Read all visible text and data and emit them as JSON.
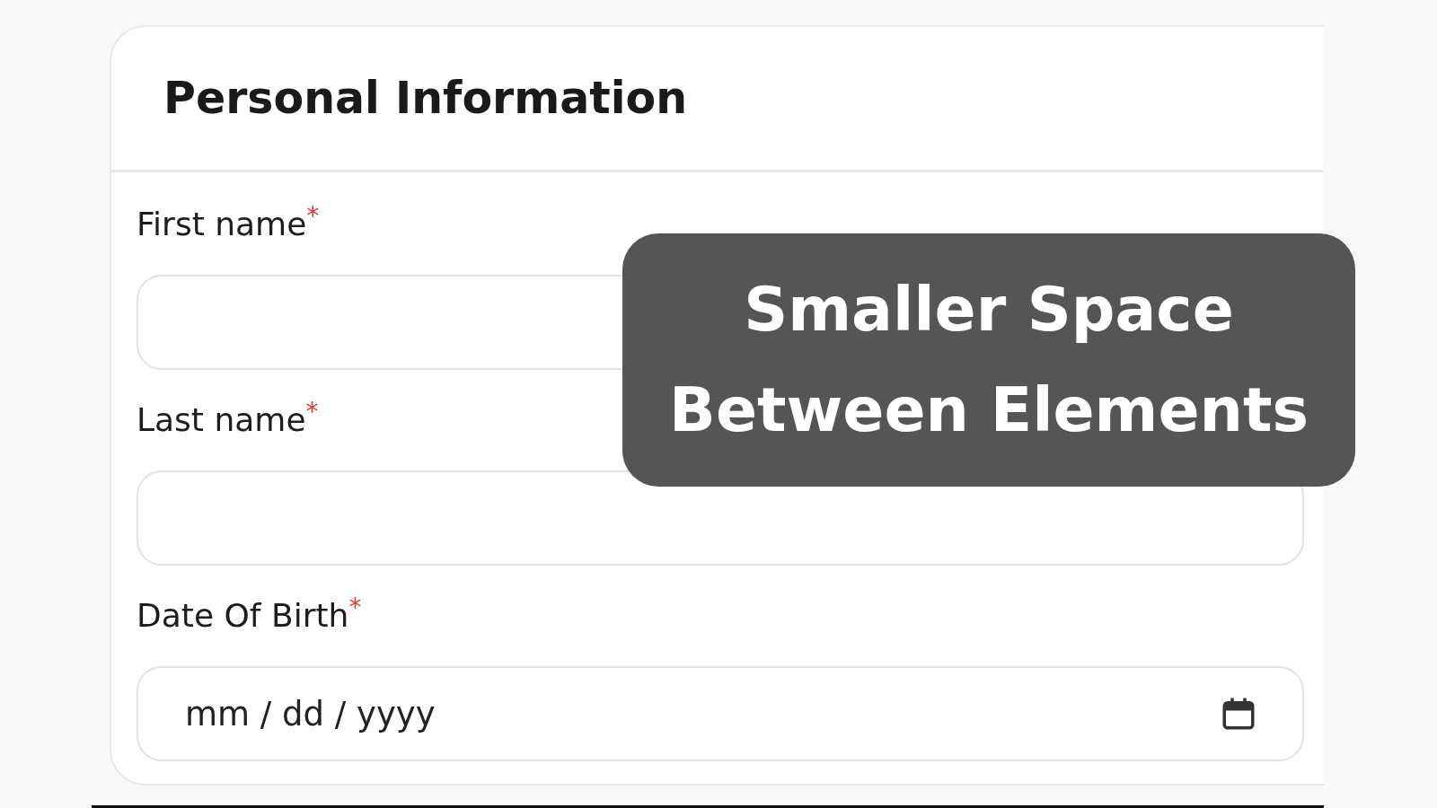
{
  "card": {
    "title": "Personal Information",
    "fields": [
      {
        "label": "First name",
        "required_mark": "*",
        "kind": "text"
      },
      {
        "label": "Last name",
        "required_mark": "*",
        "kind": "text"
      },
      {
        "label": "Date Of Birth",
        "required_mark": "*",
        "kind": "date",
        "placeholder": "mm / dd / yyyy"
      }
    ]
  },
  "overlay_caption": "Smaller Space Between Elements"
}
